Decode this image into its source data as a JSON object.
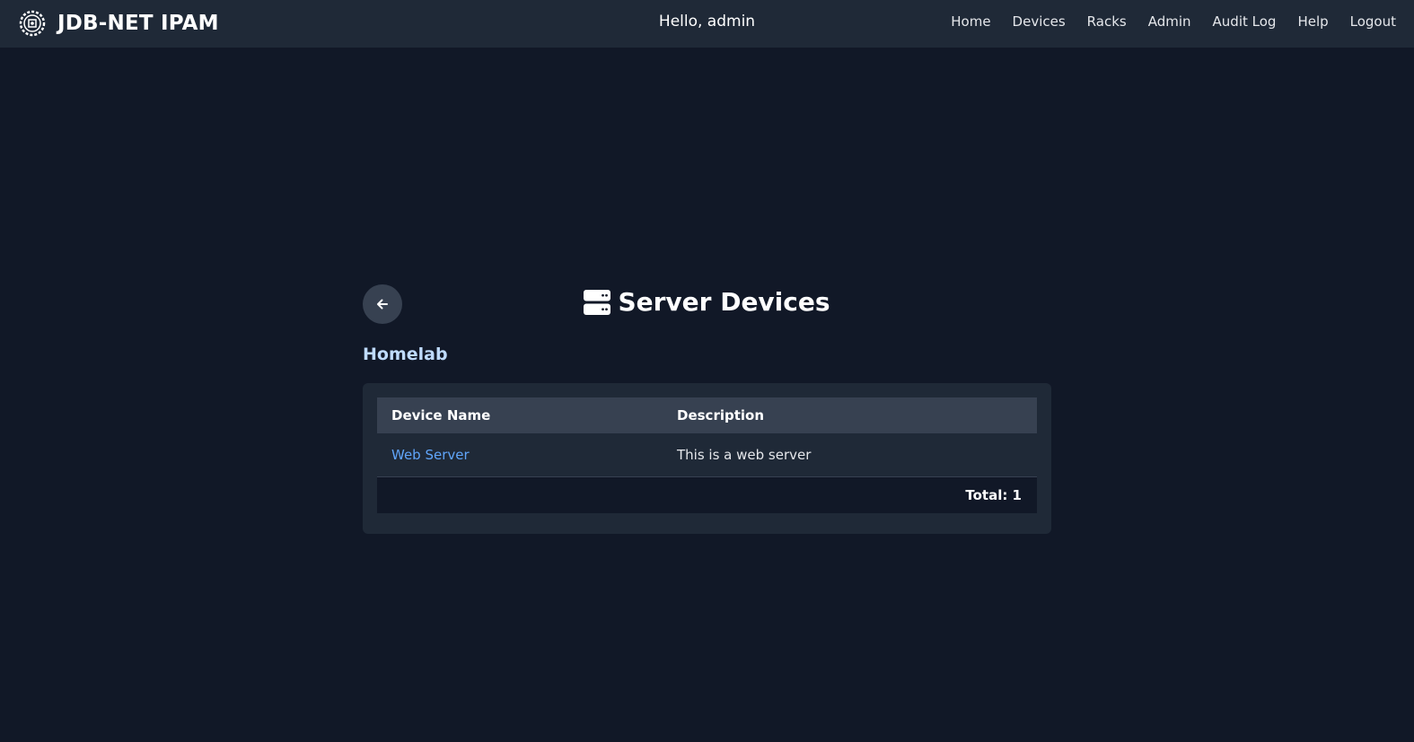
{
  "header": {
    "brand_title": "JDB-NET IPAM",
    "logo_icon": "gear-chip-icon",
    "greeting": "Hello, admin",
    "nav": [
      {
        "label": "Home"
      },
      {
        "label": "Devices"
      },
      {
        "label": "Racks"
      },
      {
        "label": "Admin"
      },
      {
        "label": "Audit Log"
      },
      {
        "label": "Help"
      },
      {
        "label": "Logout"
      }
    ]
  },
  "page": {
    "back_icon": "arrow-left-icon",
    "title_icon": "server-icon",
    "title": "Server Devices",
    "group": "Homelab"
  },
  "table": {
    "columns": [
      "Device Name",
      "Description"
    ],
    "rows": [
      {
        "name": "Web Server",
        "description": "This is a web server"
      }
    ],
    "total": "Total: 1"
  },
  "colors": {
    "background": "#111827",
    "navbar": "#1f2937",
    "card": "#1f2937",
    "table_header": "#374151",
    "link": "#60a5fa",
    "group_title": "#bfdbfe"
  }
}
